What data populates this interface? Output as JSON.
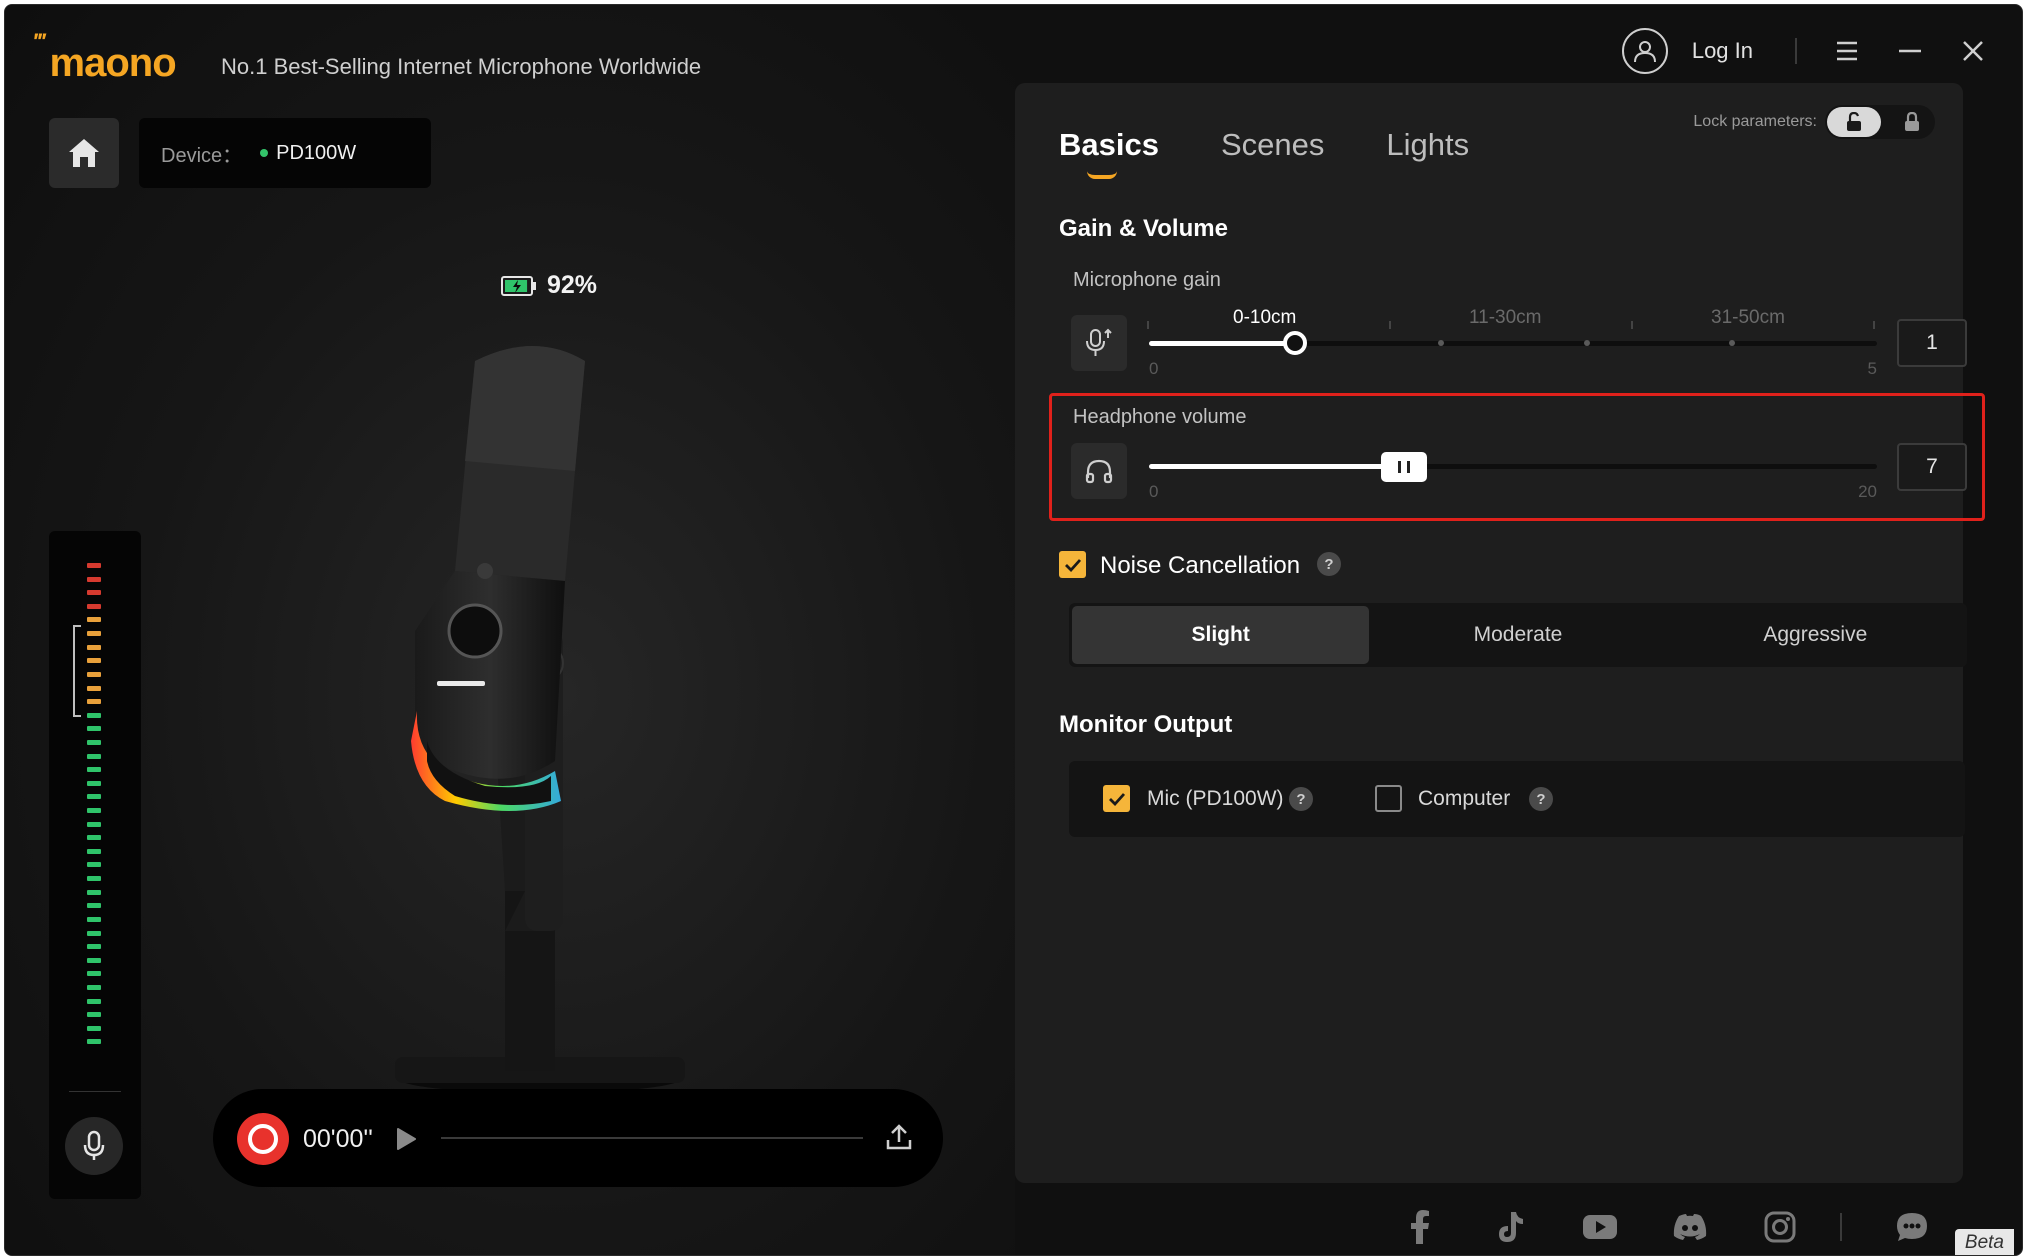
{
  "header": {
    "logo_text": "maono",
    "slogan": "No.1 Best-Selling Internet Microphone Worldwide",
    "login_label": "Log In"
  },
  "device": {
    "label": "Device：",
    "name": "PD100W",
    "status_color": "#33c46a"
  },
  "battery": {
    "percent_text": "92%",
    "level": 0.92
  },
  "meter": {
    "bar_count": 36,
    "colors": {
      "red": "#d63a2f",
      "orange": "#e9a13b",
      "green": "#2fc46a"
    }
  },
  "recorder": {
    "time": "00'00''"
  },
  "tabs": [
    {
      "label": "Basics",
      "active": true
    },
    {
      "label": "Scenes",
      "active": false
    },
    {
      "label": "Lights",
      "active": false
    }
  ],
  "lock": {
    "label": "Lock parameters:",
    "unlocked": true
  },
  "gain_volume": {
    "title": "Gain & Volume",
    "mic_gain": {
      "label": "Microphone gain",
      "min": "0",
      "max": "5",
      "value": 1,
      "value_text": "1",
      "zones": [
        "0-10cm",
        "11-30cm",
        "31-50cm"
      ],
      "active_zone": 0
    },
    "headphone": {
      "label": "Headphone volume",
      "min": "0",
      "max": "20",
      "value": 7,
      "value_text": "7"
    }
  },
  "noise": {
    "label": "Noise Cancellation",
    "checked": true,
    "help": "?",
    "options": [
      "Slight",
      "Moderate",
      "Aggressive"
    ],
    "selected": 0
  },
  "monitor": {
    "title": "Monitor Output",
    "options": [
      {
        "label": "Mic (PD100W)",
        "checked": true,
        "help": "?"
      },
      {
        "label": "Computer",
        "checked": false,
        "help": "?"
      }
    ]
  },
  "social": [
    "facebook-icon",
    "tiktok-icon",
    "youtube-icon",
    "discord-icon",
    "instagram-icon",
    "chat-icon"
  ],
  "beta_label": "Beta",
  "accent_color": "#f5a623",
  "highlight_color": "#e0211b"
}
